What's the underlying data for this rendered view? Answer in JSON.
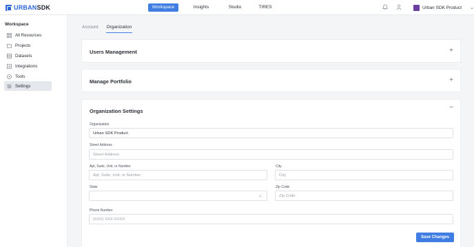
{
  "brand": {
    "text_bold": "URBAN",
    "text_rest": "SDK"
  },
  "nav": {
    "items": [
      {
        "label": "Workspace",
        "active": true
      },
      {
        "label": "Insights",
        "active": false
      },
      {
        "label": "Studio",
        "active": false
      },
      {
        "label": "TIRES",
        "active": false
      }
    ]
  },
  "header": {
    "org_name": "Urban SDK Product",
    "icons": [
      "bell-icon",
      "user-icon",
      "chevron-down-icon"
    ]
  },
  "sidebar": {
    "title": "Workspace",
    "items": [
      {
        "label": "All Resources",
        "icon": "grid-icon",
        "active": false
      },
      {
        "label": "Projects",
        "icon": "folder-icon",
        "active": false
      },
      {
        "label": "Datasets",
        "icon": "table-icon",
        "active": false
      },
      {
        "label": "Integrations",
        "icon": "chart-icon",
        "active": false
      },
      {
        "label": "Tools",
        "icon": "compass-icon",
        "active": false
      },
      {
        "label": "Settings",
        "icon": "sliders-icon",
        "active": true
      }
    ]
  },
  "tabs": [
    {
      "label": "Account",
      "active": false
    },
    {
      "label": "Organization",
      "active": true
    }
  ],
  "sections": {
    "users": {
      "title": "Users Management",
      "toggle": "+"
    },
    "portfolio": {
      "title": "Manage Portfolio",
      "toggle": "+"
    },
    "org_settings": {
      "title": "Organization Settings",
      "toggle": "−"
    }
  },
  "form": {
    "organization": {
      "label": "Organization",
      "value": "Urban SDK Product"
    },
    "street": {
      "label": "Street Address",
      "placeholder": "Street Address"
    },
    "apt": {
      "label": "Apt, Suite, Unit, or Number",
      "placeholder": "Apt, Suite, Unit, or Number"
    },
    "city": {
      "label": "City",
      "placeholder": "City"
    },
    "state": {
      "label": "State",
      "value": ""
    },
    "zip": {
      "label": "Zip Code",
      "placeholder": "Zip Code"
    },
    "phone": {
      "label": "Phone Number",
      "placeholder": "(XXX) XXX-XXXX"
    },
    "save_label": "Save Changes"
  },
  "colors": {
    "accent": "#3f7de3",
    "brand": "#2b66d9",
    "org_badge": "#6b3fa0"
  }
}
